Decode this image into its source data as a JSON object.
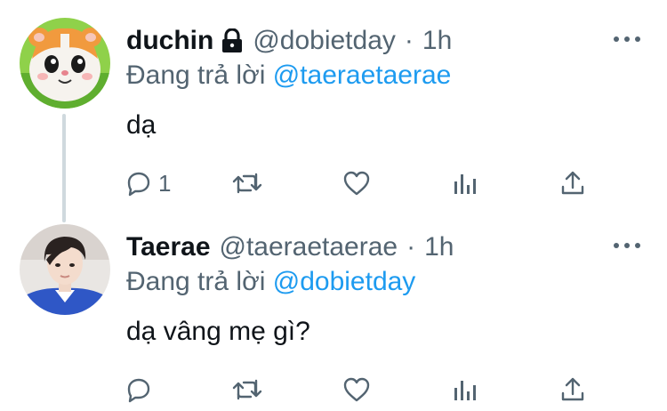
{
  "tweets": [
    {
      "display_name": "duchin",
      "protected": true,
      "handle": "@dobietday",
      "separator": "·",
      "time": "1h",
      "reply_prefix": "Đang trả lời",
      "reply_target": "@taeraetaerae",
      "text": "dạ",
      "reply_count": "1",
      "avatar_icon": "hamster-avatar-icon"
    },
    {
      "display_name": "Taerae",
      "protected": false,
      "handle": "@taeraetaerae",
      "separator": "·",
      "time": "1h",
      "reply_prefix": "Đang trả lời",
      "reply_target": "@dobietday",
      "text": "dạ vâng mẹ gì?",
      "reply_count": "",
      "avatar_icon": "person-avatar-icon"
    }
  ],
  "icons": {
    "more": "more-icon",
    "reply": "reply-icon",
    "retweet": "retweet-icon",
    "like": "like-icon",
    "views": "views-icon",
    "share": "share-icon",
    "lock": "lock-icon"
  },
  "colors": {
    "text_primary": "#0f1419",
    "text_secondary": "#536471",
    "link": "#1d9bf0",
    "thread_line": "#cfd9de"
  }
}
